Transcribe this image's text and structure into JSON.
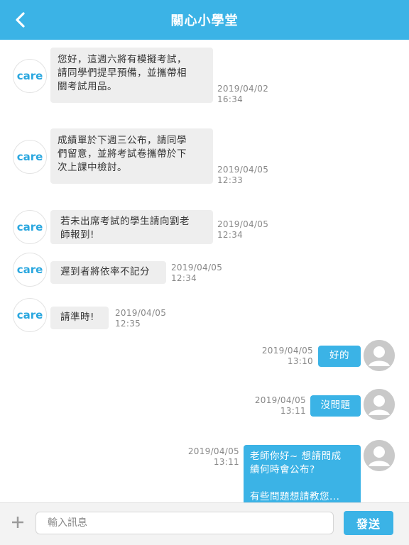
{
  "header": {
    "title": "關心小學堂",
    "back_icon": "chevron-left-icon"
  },
  "colors": {
    "accent": "#3bb3e6",
    "bubble_in": "#eeeeee",
    "care_logo": "#2aa7df"
  },
  "incoming": [
    {
      "sender": "care",
      "lines": [
        "您好，這週六將有模擬考試，",
        "請同學們提早預備，並攜帶相",
        "關考試用品。"
      ],
      "date": "2019/04/02",
      "time": "16:34"
    },
    {
      "sender": "care",
      "lines": [
        "成績單於下週三公布，請同學",
        "們留意，並將考試卷攜帶於下",
        "次上課中檢討。"
      ],
      "date": "2019/04/05",
      "time": "12:33"
    },
    {
      "sender": "care",
      "lines": [
        "若未出席考試的學生請向劉老",
        "師報到!"
      ],
      "date": "2019/04/05",
      "time": "12:34"
    },
    {
      "sender": "care",
      "lines": [
        "遲到者將依率不記分"
      ],
      "date": "2019/04/05",
      "time": "12:34"
    },
    {
      "sender": "care",
      "lines": [
        "請準時!"
      ],
      "date": "2019/04/05",
      "time": "12:35"
    }
  ],
  "outgoing": [
    {
      "lines": [
        "好的"
      ],
      "date": "2019/04/05",
      "time": "13:10"
    },
    {
      "lines": [
        "沒問題"
      ],
      "date": "2019/04/05",
      "time": "13:11"
    },
    {
      "lines": [
        "老師你好~ 想請問成",
        "績何時會公布?",
        "",
        "有些問題想請教您..."
      ],
      "date": "2019/04/05",
      "time": "13:11"
    }
  ],
  "input_bar": {
    "placeholder": "輸入訊息",
    "send_label": "發送",
    "plus_icon": "plus-icon"
  }
}
